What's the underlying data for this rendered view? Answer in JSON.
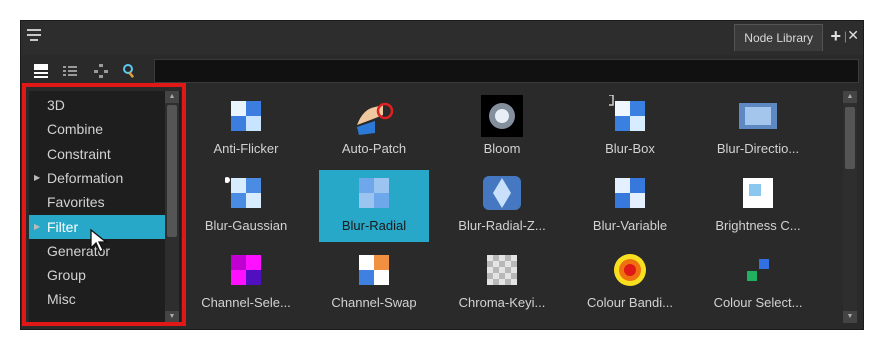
{
  "panel": {
    "tab_label": "Node Library"
  },
  "search": {
    "value": ""
  },
  "categories": [
    {
      "label": "3D",
      "arrow": ""
    },
    {
      "label": "Combine",
      "arrow": ""
    },
    {
      "label": "Constraint",
      "arrow": ""
    },
    {
      "label": "Deformation",
      "arrow": "▶"
    },
    {
      "label": "Favorites",
      "arrow": ""
    },
    {
      "label": "Filter",
      "arrow": "▶",
      "selected": true
    },
    {
      "label": "Generator",
      "arrow": ""
    },
    {
      "label": "Group",
      "arrow": ""
    },
    {
      "label": "Misc",
      "arrow": ""
    }
  ],
  "nodes": [
    {
      "label": "Anti-Flicker",
      "icon": "anti-flicker-icon"
    },
    {
      "label": "Auto-Patch",
      "icon": "auto-patch-icon"
    },
    {
      "label": "Bloom",
      "icon": "bloom-icon"
    },
    {
      "label": "Blur-Box",
      "icon": "blur-box-icon"
    },
    {
      "label": "Blur-Directio...",
      "icon": "blur-directional-icon"
    },
    {
      "label": "Blur-Gaussian",
      "icon": "blur-gaussian-icon"
    },
    {
      "label": "Blur-Radial",
      "icon": "blur-radial-icon",
      "selected": true
    },
    {
      "label": "Blur-Radial-Z...",
      "icon": "blur-radial-zoom-icon"
    },
    {
      "label": "Blur-Variable",
      "icon": "blur-variable-icon"
    },
    {
      "label": "Brightness C...",
      "icon": "brightness-contrast-icon"
    },
    {
      "label": "Channel-Sele...",
      "icon": "channel-selector-icon"
    },
    {
      "label": "Channel-Swap",
      "icon": "channel-swap-icon"
    },
    {
      "label": "Chroma-Keyi...",
      "icon": "chroma-keying-icon"
    },
    {
      "label": "Colour Bandi...",
      "icon": "colour-banding-icon"
    },
    {
      "label": "Colour Select...",
      "icon": "colour-selector-icon"
    }
  ],
  "colors": {
    "selection": "#28a8c8",
    "highlight": "#e01818",
    "panel_bg": "#2a2a2a"
  }
}
